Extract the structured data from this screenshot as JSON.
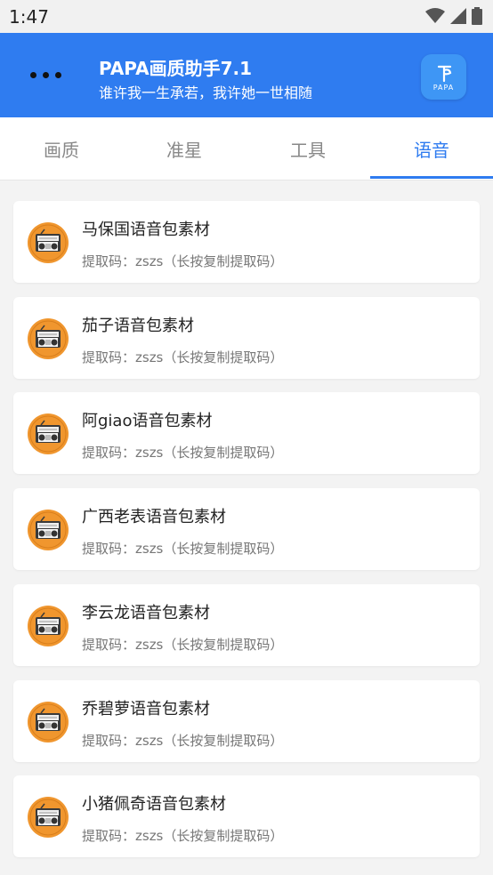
{
  "status_bar": {
    "time": "1:47"
  },
  "header": {
    "title": "PAPA画质助手7.1",
    "subtitle": "谁许我一生承若，我许她一世相随",
    "logo_text": "PAPA"
  },
  "tabs": [
    {
      "label": "画质"
    },
    {
      "label": "准星"
    },
    {
      "label": "工具"
    },
    {
      "label": "语音",
      "active": true
    }
  ],
  "items": [
    {
      "name": "马保国语音包素材",
      "code": "提取码：zszs（长按复制提取码）"
    },
    {
      "name": "茄子语音包素材",
      "code": "提取码：zszs（长按复制提取码）"
    },
    {
      "name": "阿giao语音包素材",
      "code": "提取码：zszs（长按复制提取码）"
    },
    {
      "name": "广西老表语音包素材",
      "code": "提取码：zszs（长按复制提取码）"
    },
    {
      "name": "李云龙语音包素材",
      "code": "提取码：zszs（长按复制提取码）"
    },
    {
      "name": "乔碧萝语音包素材",
      "code": "提取码：zszs（长按复制提取码）"
    },
    {
      "name": "小猪佩奇语音包素材",
      "code": "提取码：zszs（长按复制提取码）"
    }
  ],
  "colors": {
    "accent": "#2f7cf0",
    "icon_orange": "#f0962e"
  }
}
